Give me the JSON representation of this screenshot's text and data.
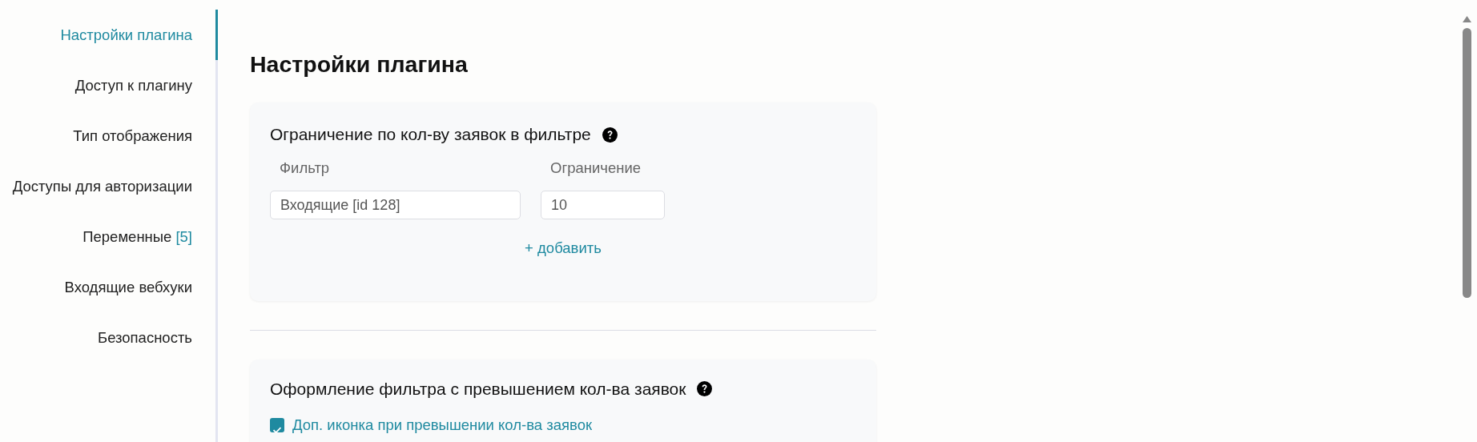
{
  "sidebar": {
    "items": [
      {
        "label": "Настройки плагина",
        "selected": true
      },
      {
        "label": "Доступ к плагину",
        "selected": false
      },
      {
        "label": "Тип отображения",
        "selected": false
      },
      {
        "label": "Доступы для авторизации",
        "selected": false
      },
      {
        "label": "Переменные",
        "count": "[5]",
        "selected": false
      },
      {
        "label": "Входящие вебхуки",
        "selected": false
      },
      {
        "label": "Безопасность",
        "selected": false
      }
    ]
  },
  "page_title": "Настройки плагина",
  "sections": [
    {
      "kind": "limits",
      "title": "Ограничение по кол-ву заявок в фильтре",
      "columns": [
        "Фильтр",
        "Ограничение"
      ],
      "rows": [
        {
          "filter": "Входящие [id 128]",
          "limit": "10"
        }
      ],
      "add_link": "+ добавить"
    },
    {
      "kind": "options",
      "title": "Оформление фильтра с превышением кол-ва заявок",
      "checkboxes": [
        {
          "label": "Доп. иконка при превышении кол-ва заявок",
          "checked": true
        }
      ]
    }
  ]
}
